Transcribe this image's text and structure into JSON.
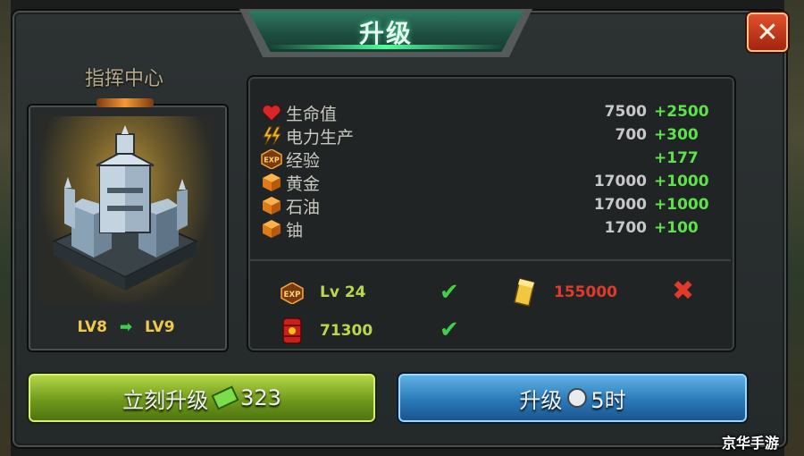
{
  "dialog": {
    "title": "升级",
    "close_label": "✕"
  },
  "building": {
    "name": "指挥中心",
    "level_from": "LV8",
    "level_to": "LV9"
  },
  "stats": [
    {
      "icon": "heart-icon",
      "label": "生命值",
      "value": "7500",
      "bonus": "+2500"
    },
    {
      "icon": "lightning-icon",
      "label": "电力生产",
      "value": "700",
      "bonus": "+300"
    },
    {
      "icon": "exp-icon",
      "label": "经验",
      "value": "",
      "bonus": "+177"
    },
    {
      "icon": "resource-cube-icon",
      "label": "黄金",
      "value": "17000",
      "bonus": "+1000"
    },
    {
      "icon": "resource-cube-icon",
      "label": "石油",
      "value": "17000",
      "bonus": "+1000"
    },
    {
      "icon": "resource-cube-icon",
      "label": "铀",
      "value": "1700",
      "bonus": "+100"
    }
  ],
  "requirements": {
    "level": {
      "icon": "exp-icon",
      "text": "Lv 24",
      "status": "met"
    },
    "gold": {
      "icon": "gold-bar-icon",
      "text": "155000",
      "status": "unmet"
    },
    "oil": {
      "icon": "oil-barrel-icon",
      "text": "71300",
      "status": "met"
    }
  },
  "buttons": {
    "instant_label": "立刻升级",
    "instant_cost": "323",
    "upgrade_label": "升级",
    "upgrade_time": "5时"
  },
  "watermark": "京华手游",
  "colors": {
    "met": "#3ed14a",
    "unmet": "#e23a2a",
    "bonus": "#5ee24a",
    "gold_text": "#f0c94a"
  }
}
